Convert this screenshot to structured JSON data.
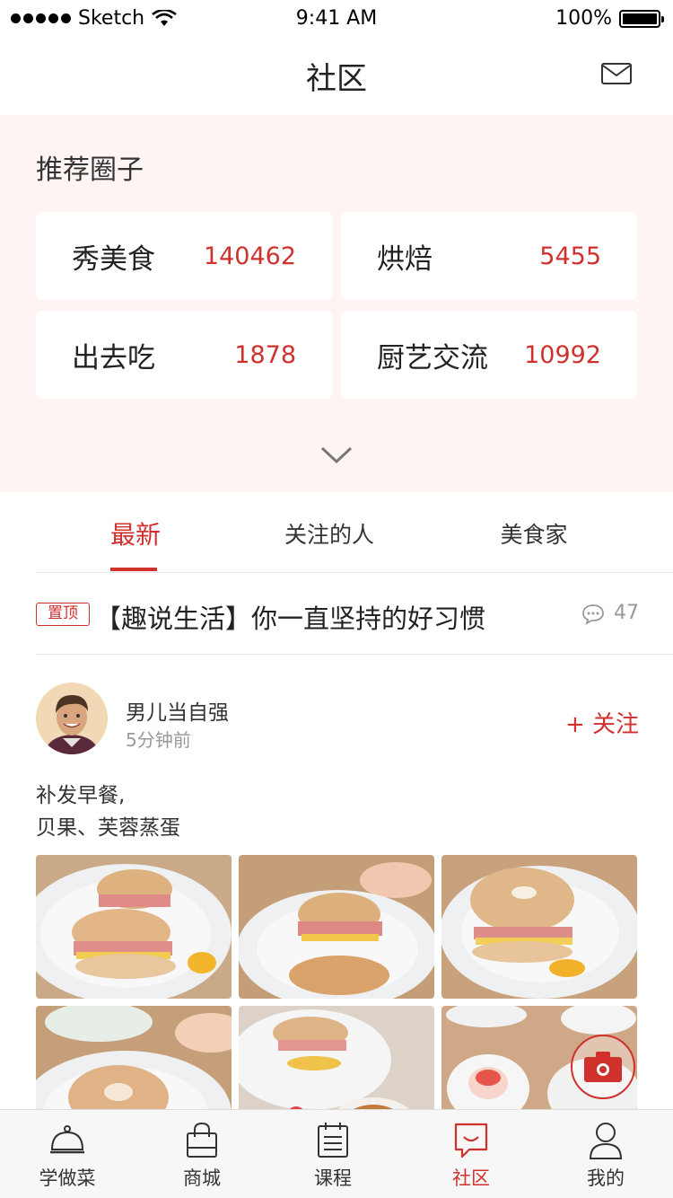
{
  "status_bar": {
    "carrier": "Sketch",
    "time": "9:41 AM",
    "battery": "100%"
  },
  "header": {
    "title": "社区",
    "mail_icon": "mail-icon"
  },
  "recommended": {
    "heading": "推荐圈子",
    "circles": [
      {
        "name": "秀美食",
        "count": "140462"
      },
      {
        "name": "烘焙",
        "count": "5455"
      },
      {
        "name": "出去吃",
        "count": "1878"
      },
      {
        "name": "厨艺交流",
        "count": "10992"
      }
    ],
    "expand_icon": "chevron-down-icon"
  },
  "tabs": [
    {
      "label": "最新",
      "active": true
    },
    {
      "label": "关注的人",
      "active": false
    },
    {
      "label": "美食家",
      "active": false
    }
  ],
  "pinned": {
    "badge": "置顶",
    "title": "【趣说生活】你一直坚持的好习惯",
    "comments": "47"
  },
  "post": {
    "username": "男儿当自强",
    "time": "5分钟前",
    "follow_label": "+ 关注",
    "text_lines": [
      "补发早餐,",
      "贝果、芙蓉蒸蛋"
    ],
    "photo_count": 6
  },
  "bottom_nav": [
    {
      "label": "学做菜",
      "icon": "cloche-icon",
      "active": false
    },
    {
      "label": "商城",
      "icon": "shopping-bag-icon",
      "active": false
    },
    {
      "label": "课程",
      "icon": "calendar-icon",
      "active": false
    },
    {
      "label": "社区",
      "icon": "chat-bubble-icon",
      "active": true
    },
    {
      "label": "我的",
      "icon": "user-icon",
      "active": false
    }
  ],
  "colors": {
    "accent": "#d0312d",
    "section_bg": "#fdf4f3"
  }
}
